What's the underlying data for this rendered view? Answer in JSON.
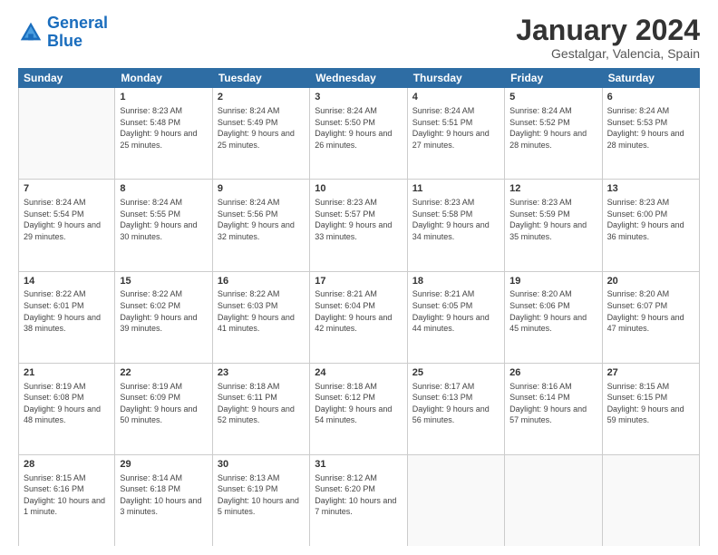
{
  "logo": {
    "line1": "General",
    "line2": "Blue"
  },
  "title": "January 2024",
  "subtitle": "Gestalgar, Valencia, Spain",
  "header_days": [
    "Sunday",
    "Monday",
    "Tuesday",
    "Wednesday",
    "Thursday",
    "Friday",
    "Saturday"
  ],
  "weeks": [
    [
      {
        "day": "",
        "sunrise": "",
        "sunset": "",
        "daylight": ""
      },
      {
        "day": "1",
        "sunrise": "Sunrise: 8:23 AM",
        "sunset": "Sunset: 5:48 PM",
        "daylight": "Daylight: 9 hours and 25 minutes."
      },
      {
        "day": "2",
        "sunrise": "Sunrise: 8:24 AM",
        "sunset": "Sunset: 5:49 PM",
        "daylight": "Daylight: 9 hours and 25 minutes."
      },
      {
        "day": "3",
        "sunrise": "Sunrise: 8:24 AM",
        "sunset": "Sunset: 5:50 PM",
        "daylight": "Daylight: 9 hours and 26 minutes."
      },
      {
        "day": "4",
        "sunrise": "Sunrise: 8:24 AM",
        "sunset": "Sunset: 5:51 PM",
        "daylight": "Daylight: 9 hours and 27 minutes."
      },
      {
        "day": "5",
        "sunrise": "Sunrise: 8:24 AM",
        "sunset": "Sunset: 5:52 PM",
        "daylight": "Daylight: 9 hours and 28 minutes."
      },
      {
        "day": "6",
        "sunrise": "Sunrise: 8:24 AM",
        "sunset": "Sunset: 5:53 PM",
        "daylight": "Daylight: 9 hours and 28 minutes."
      }
    ],
    [
      {
        "day": "7",
        "sunrise": "Sunrise: 8:24 AM",
        "sunset": "Sunset: 5:54 PM",
        "daylight": "Daylight: 9 hours and 29 minutes."
      },
      {
        "day": "8",
        "sunrise": "Sunrise: 8:24 AM",
        "sunset": "Sunset: 5:55 PM",
        "daylight": "Daylight: 9 hours and 30 minutes."
      },
      {
        "day": "9",
        "sunrise": "Sunrise: 8:24 AM",
        "sunset": "Sunset: 5:56 PM",
        "daylight": "Daylight: 9 hours and 32 minutes."
      },
      {
        "day": "10",
        "sunrise": "Sunrise: 8:23 AM",
        "sunset": "Sunset: 5:57 PM",
        "daylight": "Daylight: 9 hours and 33 minutes."
      },
      {
        "day": "11",
        "sunrise": "Sunrise: 8:23 AM",
        "sunset": "Sunset: 5:58 PM",
        "daylight": "Daylight: 9 hours and 34 minutes."
      },
      {
        "day": "12",
        "sunrise": "Sunrise: 8:23 AM",
        "sunset": "Sunset: 5:59 PM",
        "daylight": "Daylight: 9 hours and 35 minutes."
      },
      {
        "day": "13",
        "sunrise": "Sunrise: 8:23 AM",
        "sunset": "Sunset: 6:00 PM",
        "daylight": "Daylight: 9 hours and 36 minutes."
      }
    ],
    [
      {
        "day": "14",
        "sunrise": "Sunrise: 8:22 AM",
        "sunset": "Sunset: 6:01 PM",
        "daylight": "Daylight: 9 hours and 38 minutes."
      },
      {
        "day": "15",
        "sunrise": "Sunrise: 8:22 AM",
        "sunset": "Sunset: 6:02 PM",
        "daylight": "Daylight: 9 hours and 39 minutes."
      },
      {
        "day": "16",
        "sunrise": "Sunrise: 8:22 AM",
        "sunset": "Sunset: 6:03 PM",
        "daylight": "Daylight: 9 hours and 41 minutes."
      },
      {
        "day": "17",
        "sunrise": "Sunrise: 8:21 AM",
        "sunset": "Sunset: 6:04 PM",
        "daylight": "Daylight: 9 hours and 42 minutes."
      },
      {
        "day": "18",
        "sunrise": "Sunrise: 8:21 AM",
        "sunset": "Sunset: 6:05 PM",
        "daylight": "Daylight: 9 hours and 44 minutes."
      },
      {
        "day": "19",
        "sunrise": "Sunrise: 8:20 AM",
        "sunset": "Sunset: 6:06 PM",
        "daylight": "Daylight: 9 hours and 45 minutes."
      },
      {
        "day": "20",
        "sunrise": "Sunrise: 8:20 AM",
        "sunset": "Sunset: 6:07 PM",
        "daylight": "Daylight: 9 hours and 47 minutes."
      }
    ],
    [
      {
        "day": "21",
        "sunrise": "Sunrise: 8:19 AM",
        "sunset": "Sunset: 6:08 PM",
        "daylight": "Daylight: 9 hours and 48 minutes."
      },
      {
        "day": "22",
        "sunrise": "Sunrise: 8:19 AM",
        "sunset": "Sunset: 6:09 PM",
        "daylight": "Daylight: 9 hours and 50 minutes."
      },
      {
        "day": "23",
        "sunrise": "Sunrise: 8:18 AM",
        "sunset": "Sunset: 6:11 PM",
        "daylight": "Daylight: 9 hours and 52 minutes."
      },
      {
        "day": "24",
        "sunrise": "Sunrise: 8:18 AM",
        "sunset": "Sunset: 6:12 PM",
        "daylight": "Daylight: 9 hours and 54 minutes."
      },
      {
        "day": "25",
        "sunrise": "Sunrise: 8:17 AM",
        "sunset": "Sunset: 6:13 PM",
        "daylight": "Daylight: 9 hours and 56 minutes."
      },
      {
        "day": "26",
        "sunrise": "Sunrise: 8:16 AM",
        "sunset": "Sunset: 6:14 PM",
        "daylight": "Daylight: 9 hours and 57 minutes."
      },
      {
        "day": "27",
        "sunrise": "Sunrise: 8:15 AM",
        "sunset": "Sunset: 6:15 PM",
        "daylight": "Daylight: 9 hours and 59 minutes."
      }
    ],
    [
      {
        "day": "28",
        "sunrise": "Sunrise: 8:15 AM",
        "sunset": "Sunset: 6:16 PM",
        "daylight": "Daylight: 10 hours and 1 minute."
      },
      {
        "day": "29",
        "sunrise": "Sunrise: 8:14 AM",
        "sunset": "Sunset: 6:18 PM",
        "daylight": "Daylight: 10 hours and 3 minutes."
      },
      {
        "day": "30",
        "sunrise": "Sunrise: 8:13 AM",
        "sunset": "Sunset: 6:19 PM",
        "daylight": "Daylight: 10 hours and 5 minutes."
      },
      {
        "day": "31",
        "sunrise": "Sunrise: 8:12 AM",
        "sunset": "Sunset: 6:20 PM",
        "daylight": "Daylight: 10 hours and 7 minutes."
      },
      {
        "day": "",
        "sunrise": "",
        "sunset": "",
        "daylight": ""
      },
      {
        "day": "",
        "sunrise": "",
        "sunset": "",
        "daylight": ""
      },
      {
        "day": "",
        "sunrise": "",
        "sunset": "",
        "daylight": ""
      }
    ]
  ]
}
